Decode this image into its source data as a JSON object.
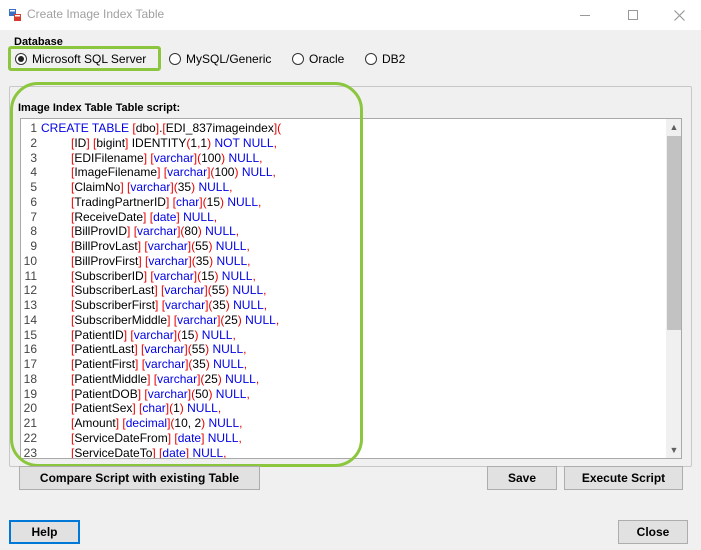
{
  "window": {
    "title": "Create Image Index Table"
  },
  "database": {
    "label": "Database",
    "options": [
      {
        "label": "Microsoft SQL Server",
        "selected": true
      },
      {
        "label": "MySQL/Generic",
        "selected": false
      },
      {
        "label": "Oracle",
        "selected": false
      },
      {
        "label": "DB2",
        "selected": false
      }
    ]
  },
  "script": {
    "label": "Image Index Table Table script:",
    "lines": [
      {
        "n": "1",
        "parts": [
          [
            "kw",
            "CREATE TABLE "
          ],
          [
            "pn",
            "["
          ],
          [
            "nm",
            "dbo"
          ],
          [
            "pn",
            "]"
          ],
          [
            "nm",
            "."
          ],
          [
            "pn",
            "["
          ],
          [
            "nm",
            "EDI_837imageindex"
          ],
          [
            "pn",
            "]("
          ]
        ]
      },
      {
        "n": "2",
        "parts": [
          [
            "pn",
            "["
          ],
          [
            "nm",
            "ID"
          ],
          [
            "pn",
            "] ["
          ],
          [
            "nm",
            "bigint"
          ],
          [
            "pn",
            "] "
          ],
          [
            "nm",
            "IDENTITY"
          ],
          [
            "pn",
            "("
          ],
          [
            "nm",
            "1"
          ],
          [
            "pn",
            ","
          ],
          [
            "nm",
            "1"
          ],
          [
            "pn",
            ") "
          ],
          [
            "kw",
            "NOT NULL"
          ],
          [
            "pn",
            ","
          ]
        ]
      },
      {
        "n": "3",
        "parts": [
          [
            "pn",
            "["
          ],
          [
            "nm",
            "EDIFilename"
          ],
          [
            "pn",
            "] ["
          ],
          [
            "ty",
            "varchar"
          ],
          [
            "pn",
            "]("
          ],
          [
            "nm",
            "100"
          ],
          [
            "pn",
            ") "
          ],
          [
            "kw",
            "NULL"
          ],
          [
            "pn",
            ","
          ]
        ]
      },
      {
        "n": "4",
        "parts": [
          [
            "pn",
            "["
          ],
          [
            "nm",
            "ImageFilename"
          ],
          [
            "pn",
            "] ["
          ],
          [
            "ty",
            "varchar"
          ],
          [
            "pn",
            "]("
          ],
          [
            "nm",
            "100"
          ],
          [
            "pn",
            ") "
          ],
          [
            "kw",
            "NULL"
          ],
          [
            "pn",
            ","
          ]
        ]
      },
      {
        "n": "5",
        "parts": [
          [
            "pn",
            "["
          ],
          [
            "nm",
            "ClaimNo"
          ],
          [
            "pn",
            "] ["
          ],
          [
            "ty",
            "varchar"
          ],
          [
            "pn",
            "]("
          ],
          [
            "nm",
            "35"
          ],
          [
            "pn",
            ") "
          ],
          [
            "kw",
            "NULL"
          ],
          [
            "pn",
            ","
          ]
        ]
      },
      {
        "n": "6",
        "parts": [
          [
            "pn",
            "["
          ],
          [
            "nm",
            "TradingPartnerID"
          ],
          [
            "pn",
            "] ["
          ],
          [
            "ty",
            "char"
          ],
          [
            "pn",
            "]("
          ],
          [
            "nm",
            "15"
          ],
          [
            "pn",
            ") "
          ],
          [
            "kw",
            "NULL"
          ],
          [
            "pn",
            ","
          ]
        ]
      },
      {
        "n": "7",
        "parts": [
          [
            "pn",
            "["
          ],
          [
            "nm",
            "ReceiveDate"
          ],
          [
            "pn",
            "] ["
          ],
          [
            "ty",
            "date"
          ],
          [
            "pn",
            "] "
          ],
          [
            "kw",
            "NULL"
          ],
          [
            "pn",
            ","
          ]
        ]
      },
      {
        "n": "8",
        "parts": [
          [
            "pn",
            "["
          ],
          [
            "nm",
            "BillProvID"
          ],
          [
            "pn",
            "] ["
          ],
          [
            "ty",
            "varchar"
          ],
          [
            "pn",
            "]("
          ],
          [
            "nm",
            "80"
          ],
          [
            "pn",
            ") "
          ],
          [
            "kw",
            "NULL"
          ],
          [
            "pn",
            ","
          ]
        ]
      },
      {
        "n": "9",
        "parts": [
          [
            "pn",
            "["
          ],
          [
            "nm",
            "BillProvLast"
          ],
          [
            "pn",
            "] ["
          ],
          [
            "ty",
            "varchar"
          ],
          [
            "pn",
            "]("
          ],
          [
            "nm",
            "55"
          ],
          [
            "pn",
            ") "
          ],
          [
            "kw",
            "NULL"
          ],
          [
            "pn",
            ","
          ]
        ]
      },
      {
        "n": "10",
        "parts": [
          [
            "pn",
            "["
          ],
          [
            "nm",
            "BillProvFirst"
          ],
          [
            "pn",
            "] ["
          ],
          [
            "ty",
            "varchar"
          ],
          [
            "pn",
            "]("
          ],
          [
            "nm",
            "35"
          ],
          [
            "pn",
            ") "
          ],
          [
            "kw",
            "NULL"
          ],
          [
            "pn",
            ","
          ]
        ]
      },
      {
        "n": "11",
        "parts": [
          [
            "pn",
            "["
          ],
          [
            "nm",
            "SubscriberID"
          ],
          [
            "pn",
            "] ["
          ],
          [
            "ty",
            "varchar"
          ],
          [
            "pn",
            "]("
          ],
          [
            "nm",
            "15"
          ],
          [
            "pn",
            ") "
          ],
          [
            "kw",
            "NULL"
          ],
          [
            "pn",
            ","
          ]
        ]
      },
      {
        "n": "12",
        "parts": [
          [
            "pn",
            "["
          ],
          [
            "nm",
            "SubscriberLast"
          ],
          [
            "pn",
            "] ["
          ],
          [
            "ty",
            "varchar"
          ],
          [
            "pn",
            "]("
          ],
          [
            "nm",
            "55"
          ],
          [
            "pn",
            ") "
          ],
          [
            "kw",
            "NULL"
          ],
          [
            "pn",
            ","
          ]
        ]
      },
      {
        "n": "13",
        "parts": [
          [
            "pn",
            "["
          ],
          [
            "nm",
            "SubscriberFirst"
          ],
          [
            "pn",
            "] ["
          ],
          [
            "ty",
            "varchar"
          ],
          [
            "pn",
            "]("
          ],
          [
            "nm",
            "35"
          ],
          [
            "pn",
            ") "
          ],
          [
            "kw",
            "NULL"
          ],
          [
            "pn",
            ","
          ]
        ]
      },
      {
        "n": "14",
        "parts": [
          [
            "pn",
            "["
          ],
          [
            "nm",
            "SubscriberMiddle"
          ],
          [
            "pn",
            "] ["
          ],
          [
            "ty",
            "varchar"
          ],
          [
            "pn",
            "]("
          ],
          [
            "nm",
            "25"
          ],
          [
            "pn",
            ") "
          ],
          [
            "kw",
            "NULL"
          ],
          [
            "pn",
            ","
          ]
        ]
      },
      {
        "n": "15",
        "parts": [
          [
            "pn",
            "["
          ],
          [
            "nm",
            "PatientID"
          ],
          [
            "pn",
            "] ["
          ],
          [
            "ty",
            "varchar"
          ],
          [
            "pn",
            "]("
          ],
          [
            "nm",
            "15"
          ],
          [
            "pn",
            ") "
          ],
          [
            "kw",
            "NULL"
          ],
          [
            "pn",
            ","
          ]
        ]
      },
      {
        "n": "16",
        "parts": [
          [
            "pn",
            "["
          ],
          [
            "nm",
            "PatientLast"
          ],
          [
            "pn",
            "] ["
          ],
          [
            "ty",
            "varchar"
          ],
          [
            "pn",
            "]("
          ],
          [
            "nm",
            "55"
          ],
          [
            "pn",
            ") "
          ],
          [
            "kw",
            "NULL"
          ],
          [
            "pn",
            ","
          ]
        ]
      },
      {
        "n": "17",
        "parts": [
          [
            "pn",
            "["
          ],
          [
            "nm",
            "PatientFirst"
          ],
          [
            "pn",
            "] ["
          ],
          [
            "ty",
            "varchar"
          ],
          [
            "pn",
            "]("
          ],
          [
            "nm",
            "35"
          ],
          [
            "pn",
            ") "
          ],
          [
            "kw",
            "NULL"
          ],
          [
            "pn",
            ","
          ]
        ]
      },
      {
        "n": "18",
        "parts": [
          [
            "pn",
            "["
          ],
          [
            "nm",
            "PatientMiddle"
          ],
          [
            "pn",
            "] ["
          ],
          [
            "ty",
            "varchar"
          ],
          [
            "pn",
            "]("
          ],
          [
            "nm",
            "25"
          ],
          [
            "pn",
            ") "
          ],
          [
            "kw",
            "NULL"
          ],
          [
            "pn",
            ","
          ]
        ]
      },
      {
        "n": "19",
        "parts": [
          [
            "pn",
            "["
          ],
          [
            "nm",
            "PatientDOB"
          ],
          [
            "pn",
            "] ["
          ],
          [
            "ty",
            "varchar"
          ],
          [
            "pn",
            "]("
          ],
          [
            "nm",
            "50"
          ],
          [
            "pn",
            ") "
          ],
          [
            "kw",
            "NULL"
          ],
          [
            "pn",
            ","
          ]
        ]
      },
      {
        "n": "20",
        "parts": [
          [
            "pn",
            "["
          ],
          [
            "nm",
            "PatientSex"
          ],
          [
            "pn",
            "] ["
          ],
          [
            "ty",
            "char"
          ],
          [
            "pn",
            "]("
          ],
          [
            "nm",
            "1"
          ],
          [
            "pn",
            ") "
          ],
          [
            "kw",
            "NULL"
          ],
          [
            "pn",
            ","
          ]
        ]
      },
      {
        "n": "21",
        "parts": [
          [
            "pn",
            "["
          ],
          [
            "nm",
            "Amount"
          ],
          [
            "pn",
            "] ["
          ],
          [
            "ty",
            "decimal"
          ],
          [
            "pn",
            "]("
          ],
          [
            "nm",
            "10, 2"
          ],
          [
            "pn",
            ") "
          ],
          [
            "kw",
            "NULL"
          ],
          [
            "pn",
            ","
          ]
        ]
      },
      {
        "n": "22",
        "parts": [
          [
            "pn",
            "["
          ],
          [
            "nm",
            "ServiceDateFrom"
          ],
          [
            "pn",
            "] ["
          ],
          [
            "ty",
            "date"
          ],
          [
            "pn",
            "] "
          ],
          [
            "kw",
            "NULL"
          ],
          [
            "pn",
            ","
          ]
        ]
      },
      {
        "n": "23",
        "parts": [
          [
            "pn",
            "["
          ],
          [
            "nm",
            "ServiceDateTo"
          ],
          [
            "pn",
            "] ["
          ],
          [
            "ty",
            "date"
          ],
          [
            "pn",
            "] "
          ],
          [
            "kw",
            "NULL"
          ],
          [
            "pn",
            ","
          ]
        ]
      }
    ]
  },
  "buttons": {
    "compare": "Compare Script with existing Table",
    "save": "Save",
    "execute": "Execute Script",
    "help": "Help",
    "close": "Close"
  },
  "colors": {
    "highlight": "#8cc63f",
    "keyword": "#0000e6",
    "punct": "#e60000",
    "focus": "#0078d7"
  },
  "icons": {
    "app": "db-table-icon",
    "minimize": "minimize-icon",
    "maximize": "maximize-icon",
    "close": "close-icon"
  }
}
